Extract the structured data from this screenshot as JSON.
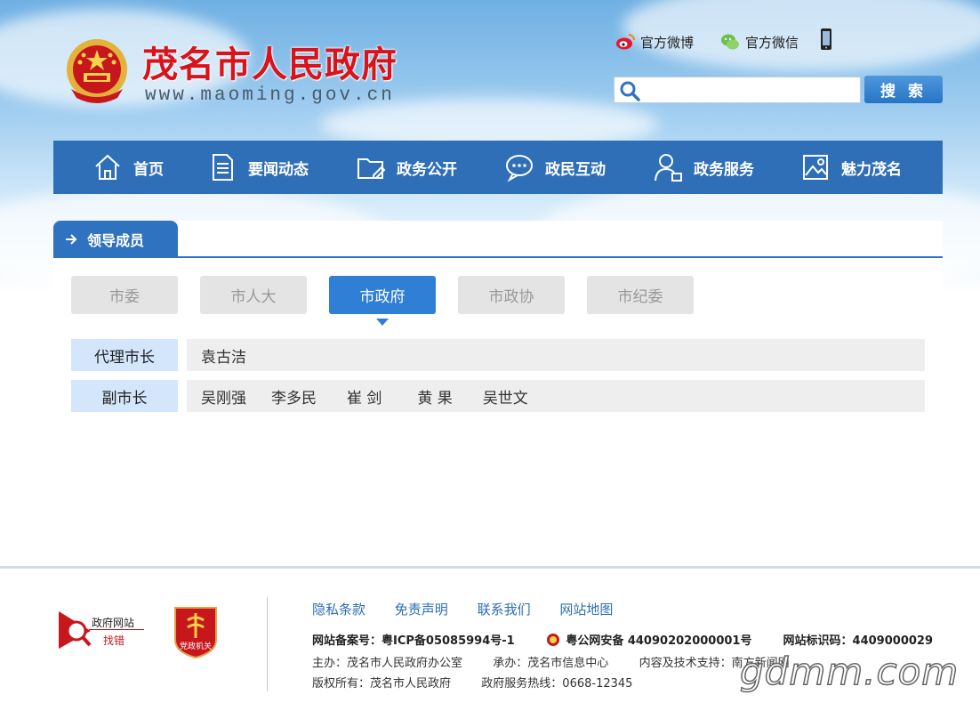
{
  "header": {
    "title": "茂名市人民政府",
    "url": "www.maoming.gov.cn",
    "weibo": "官方微博",
    "wechat": "官方微信",
    "search_placeholder": "",
    "search_button": "搜 索"
  },
  "nav": [
    {
      "label": "首页",
      "icon": "home-icon"
    },
    {
      "label": "要闻动态",
      "icon": "document-icon"
    },
    {
      "label": "政务公开",
      "icon": "folder-icon"
    },
    {
      "label": "政民互动",
      "icon": "chat-icon"
    },
    {
      "label": "政务服务",
      "icon": "user-service-icon"
    },
    {
      "label": "魅力茂名",
      "icon": "photo-icon"
    }
  ],
  "panel": {
    "title": "领导成员",
    "tabs": [
      "市委",
      "市人大",
      "市政府",
      "市政协",
      "市纪委"
    ],
    "active_tab": "市政府",
    "rows": [
      {
        "label": "代理市长",
        "names": [
          "袁古洁"
        ]
      },
      {
        "label": "副市长",
        "names": [
          "吴刚强",
          "李多民",
          "崔 剑",
          "黄 果",
          "吴世文"
        ]
      }
    ]
  },
  "footer": {
    "badge_error_line1": "政府网站",
    "badge_error_line2": "找错",
    "badge_party": "党政机关",
    "links": [
      "隐私条款",
      "免责声明",
      "联系我们",
      "网站地图"
    ],
    "icp": "网站备案号：粤ICP备05085994号-1",
    "police": "粤公网安备 44090202000001号",
    "site_id": "网站标识码：4409000029",
    "host": "主办：茂名市人民政府办公室",
    "undertaker": "承办：茂名市信息中心",
    "support": "内容及技术支持：南方新闻网",
    "copyright": "版权所有：茂名市人民政府",
    "hotline": "政府服务热线：0668-12345"
  },
  "watermark": "gdmm.com",
  "colors": {
    "brand_red": "#d8131c",
    "nav_blue": "#2f6fb8",
    "active_tab": "#2f7fd6",
    "label_bg": "#d3e6fb",
    "link_blue": "#2d6fb5"
  }
}
